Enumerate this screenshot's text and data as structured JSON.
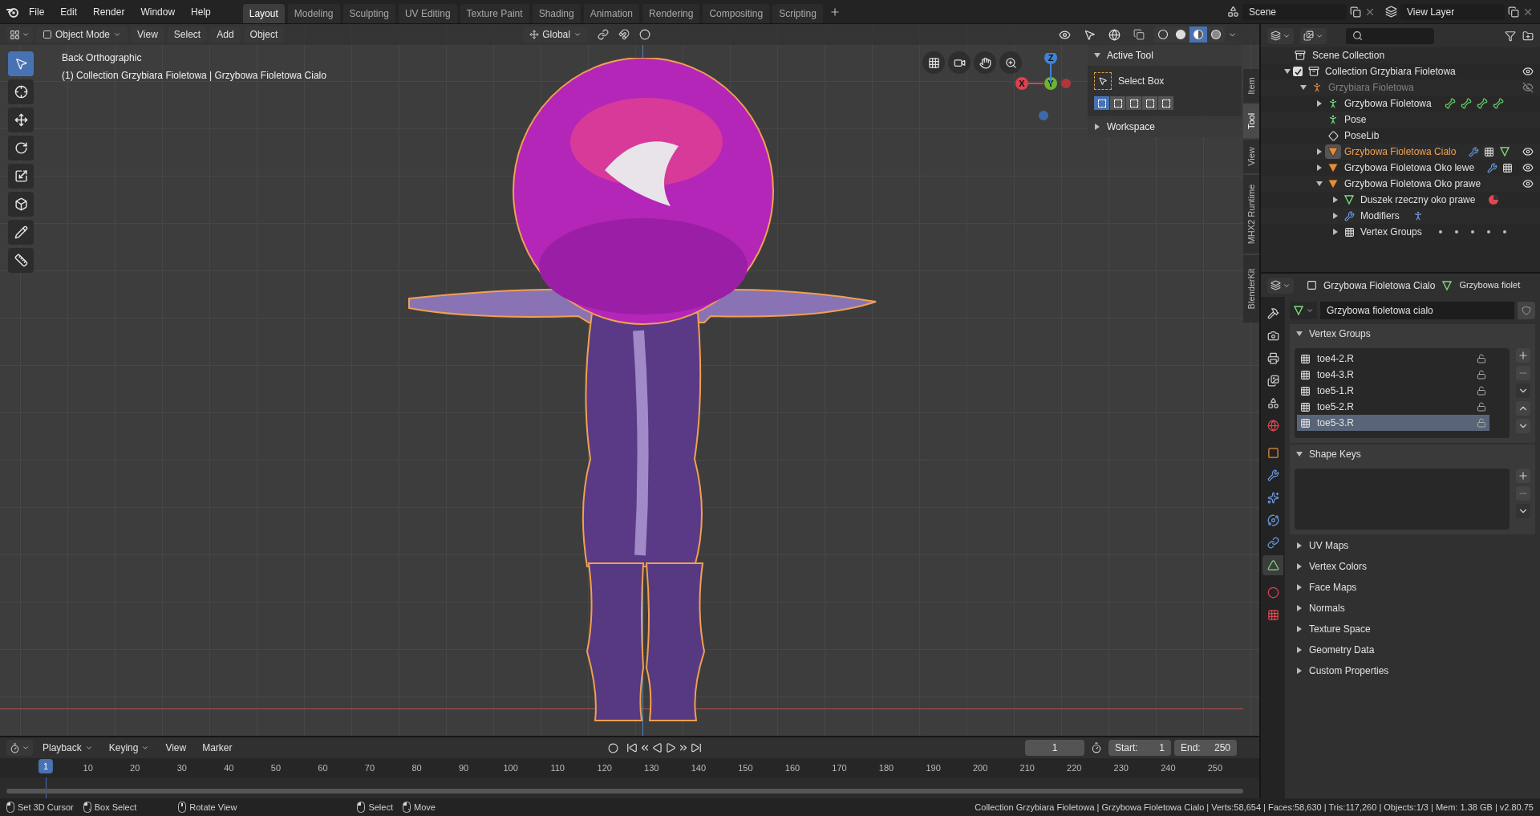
{
  "topbar": {
    "menus": [
      "File",
      "Edit",
      "Render",
      "Window",
      "Help"
    ],
    "workspaces": [
      {
        "label": "Layout",
        "selected": true
      },
      {
        "label": "Modeling",
        "selected": false
      },
      {
        "label": "Sculpting",
        "selected": false
      },
      {
        "label": "UV Editing",
        "selected": false
      },
      {
        "label": "Texture Paint",
        "selected": false
      },
      {
        "label": "Shading",
        "selected": false
      },
      {
        "label": "Animation",
        "selected": false
      },
      {
        "label": "Rendering",
        "selected": false
      },
      {
        "label": "Compositing",
        "selected": false
      },
      {
        "label": "Scripting",
        "selected": false
      }
    ],
    "scene": "Scene",
    "view_layer": "View Layer"
  },
  "viewport": {
    "mode": "Object Mode",
    "menus": [
      "View",
      "Select",
      "Add",
      "Object"
    ],
    "orientation": "Global",
    "shading": [
      {
        "kind": "wireframe",
        "selected": false
      },
      {
        "kind": "solid",
        "selected": false
      },
      {
        "kind": "material",
        "selected": true
      },
      {
        "kind": "rendered",
        "selected": false
      }
    ],
    "view_name": "Back Orthographic",
    "object_info": "(1) Collection Grzybiara Fioletowa | Grzybowa Fioletowa Cialo",
    "tools": [
      {
        "kind": "select",
        "selected": true
      },
      {
        "kind": "cursor",
        "selected": false
      },
      {
        "kind": "move",
        "selected": false
      },
      {
        "kind": "rotate",
        "selected": false
      },
      {
        "kind": "scale",
        "selected": false
      },
      {
        "kind": "transform",
        "selected": false
      },
      {
        "kind": "annotate",
        "selected": false
      },
      {
        "kind": "measure",
        "selected": false
      }
    ],
    "gizmo_axes": [
      "X",
      "Y",
      "Z"
    ],
    "sidebar": {
      "tabs": [
        {
          "label": "Item",
          "selected": false
        },
        {
          "label": "Tool",
          "selected": true
        },
        {
          "label": "View",
          "selected": false
        },
        {
          "label": "MHX2 Runtime",
          "selected": false
        },
        {
          "label": "BlenderKit",
          "selected": false
        }
      ],
      "active_tool": {
        "title": "Active Tool",
        "expanded": true,
        "tool": "Select Box",
        "modes": [
          {
            "selected": true
          },
          {
            "selected": false
          },
          {
            "selected": false
          },
          {
            "selected": false
          },
          {
            "selected": false
          }
        ]
      },
      "workspace": {
        "title": "Workspace",
        "expanded": false
      }
    }
  },
  "outliner": {
    "root": "Scene Collection",
    "items": [
      {
        "label": "Collection Grzybiara Fioletowa",
        "kind": "collection",
        "checked": true,
        "expanded": true,
        "active": false,
        "visible": true,
        "children": [
          {
            "label": "Grzybiara Fioletowa",
            "kind": "armature-object",
            "expanded": true,
            "active": false,
            "visible": false,
            "children": [
              {
                "label": "Grzybowa Fioletowa",
                "kind": "armature-data",
                "expanded": false,
                "active": false,
                "extras": [
                  {
                    "kind": "bone"
                  },
                  {
                    "kind": "bone"
                  },
                  {
                    "kind": "bone"
                  },
                  {
                    "kind": "bone"
                  }
                ]
              },
              {
                "label": "Pose",
                "kind": "pose",
                "active": false
              },
              {
                "label": "PoseLib",
                "kind": "poselib",
                "active": false
              },
              {
                "label": "Grzybowa Fioletowa Cialo",
                "kind": "mesh-object",
                "expanded": false,
                "active": true,
                "visible": true,
                "extras": [
                  {
                    "kind": "modifier"
                  },
                  {
                    "kind": "vertex-groups"
                  },
                  {
                    "kind": "mesh-data"
                  }
                ]
              },
              {
                "label": "Grzybowa Fioletowa Oko lewe",
                "kind": "mesh-object",
                "expanded": false,
                "active": false,
                "visible": true,
                "extras": [
                  {
                    "kind": "modifier"
                  },
                  {
                    "kind": "vertex-groups"
                  }
                ]
              },
              {
                "label": "Grzybowa Fioletowa Oko prawe",
                "kind": "mesh-object",
                "expanded": true,
                "active": false,
                "visible": true,
                "children": [
                  {
                    "label": "Duszek rzeczny oko prawe",
                    "kind": "mesh-data",
                    "expanded": false,
                    "active": false,
                    "extras": [
                      {
                        "kind": "material"
                      }
                    ]
                  },
                  {
                    "label": "Modifiers",
                    "kind": "modifiers",
                    "expanded": false,
                    "active": false,
                    "extras": [
                      {
                        "kind": "armature"
                      }
                    ]
                  },
                  {
                    "label": "Vertex Groups",
                    "kind": "vertex-groups",
                    "expanded": false,
                    "active": false,
                    "extras": [
                      {
                        "kind": "dot"
                      },
                      {
                        "kind": "dot"
                      },
                      {
                        "kind": "dot"
                      },
                      {
                        "kind": "dot"
                      },
                      {
                        "kind": "dot"
                      }
                    ]
                  }
                ]
              }
            ]
          }
        ]
      }
    ]
  },
  "properties": {
    "object_name": "Grzybowa Fioletowa Cialo",
    "data_name": "Grzybowa fiolet",
    "tabs": [
      {
        "kind": "tool",
        "selected": false
      },
      {
        "kind": "render",
        "selected": false
      },
      {
        "kind": "output",
        "selected": false
      },
      {
        "kind": "view-layer",
        "selected": false
      },
      {
        "kind": "scene",
        "selected": false
      },
      {
        "kind": "world",
        "selected": false
      },
      {
        "kind": "object",
        "selected": false
      },
      {
        "kind": "modifiers",
        "selected": false
      },
      {
        "kind": "particles",
        "selected": false
      },
      {
        "kind": "physics",
        "selected": false
      },
      {
        "kind": "constraints",
        "selected": false
      },
      {
        "kind": "data",
        "selected": true
      },
      {
        "kind": "material",
        "selected": false
      },
      {
        "kind": "texture",
        "selected": false
      }
    ],
    "mesh_name": "Grzybowa fioletowa cialo",
    "panels": [
      {
        "title": "Vertex Groups",
        "expanded": true,
        "items": [
          {
            "label": "toe4-2.R",
            "selected": false
          },
          {
            "label": "toe4-3.R",
            "selected": false
          },
          {
            "label": "toe5-1.R",
            "selected": false
          },
          {
            "label": "toe5-2.R",
            "selected": false
          },
          {
            "label": "toe5-3.R",
            "selected": true
          }
        ]
      },
      {
        "title": "Shape Keys",
        "expanded": true
      },
      {
        "title": "UV Maps",
        "expanded": false
      },
      {
        "title": "Vertex Colors",
        "expanded": false
      },
      {
        "title": "Face Maps",
        "expanded": false
      },
      {
        "title": "Normals",
        "expanded": false
      },
      {
        "title": "Texture Space",
        "expanded": false
      },
      {
        "title": "Geometry Data",
        "expanded": false
      },
      {
        "title": "Custom Properties",
        "expanded": false
      }
    ]
  },
  "timeline": {
    "menus": [
      "Playback",
      "Keying",
      "View",
      "Marker"
    ],
    "current_frame": "1",
    "start_label": "Start:",
    "start": "1",
    "end_label": "End:",
    "end": "250",
    "playhead": "1",
    "ruler": [
      "10",
      "20",
      "30",
      "40",
      "50",
      "60",
      "70",
      "80",
      "90",
      "100",
      "110",
      "120",
      "130",
      "140",
      "150",
      "160",
      "170",
      "180",
      "190",
      "200",
      "210",
      "220",
      "230",
      "240",
      "250"
    ]
  },
  "status_bar": {
    "hints": [
      [
        {
          "kind": "left",
          "label": "Set 3D Cursor"
        },
        {
          "kind": "drag",
          "label": "Box Select"
        },
        {
          "kind": "middle",
          "label": "Rotate View"
        }
      ],
      [
        {
          "kind": "left",
          "label": "Select"
        },
        {
          "kind": "drag",
          "label": "Move"
        }
      ]
    ],
    "stats": "Collection Grzybiara Fioletowa | Grzybowa Fioletowa Cialo | Verts:58,654 | Faces:58,630 | Tris:117,260 | Objects:1/3 | Mem: 1.38 GB | v2.80.75"
  }
}
